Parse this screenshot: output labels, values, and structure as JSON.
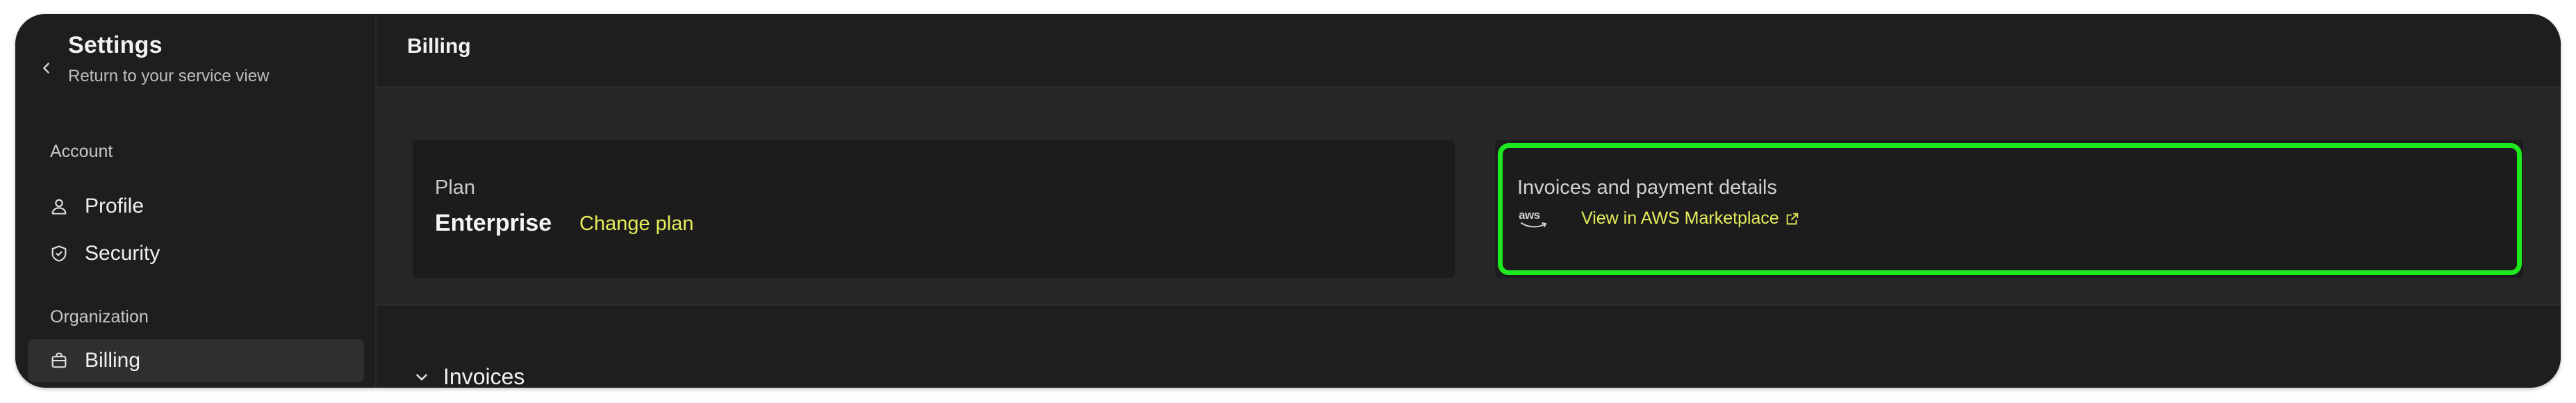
{
  "sidebar": {
    "title": "Settings",
    "subtitle": "Return to your service view",
    "sections": [
      {
        "label": "Account",
        "items": [
          {
            "label": "Profile",
            "icon": "user-icon"
          },
          {
            "label": "Security",
            "icon": "shield-icon"
          }
        ]
      },
      {
        "label": "Organization",
        "items": [
          {
            "label": "Billing",
            "icon": "billing-icon",
            "active": true
          }
        ]
      }
    ]
  },
  "header": {
    "title": "Billing"
  },
  "plan_card": {
    "label": "Plan",
    "plan_name": "Enterprise",
    "change_plan_label": "Change plan"
  },
  "invoices_card": {
    "label": "Invoices and payment details",
    "aws_logo_text": "aws",
    "marketplace_link_label": "View in AWS Marketplace"
  },
  "invoices_section": {
    "label": "Invoices"
  },
  "colors": {
    "accent": "#e6ec5a",
    "highlight": "#1ee81e",
    "background": "#1e1e1e",
    "card": "#1c1c1c"
  }
}
